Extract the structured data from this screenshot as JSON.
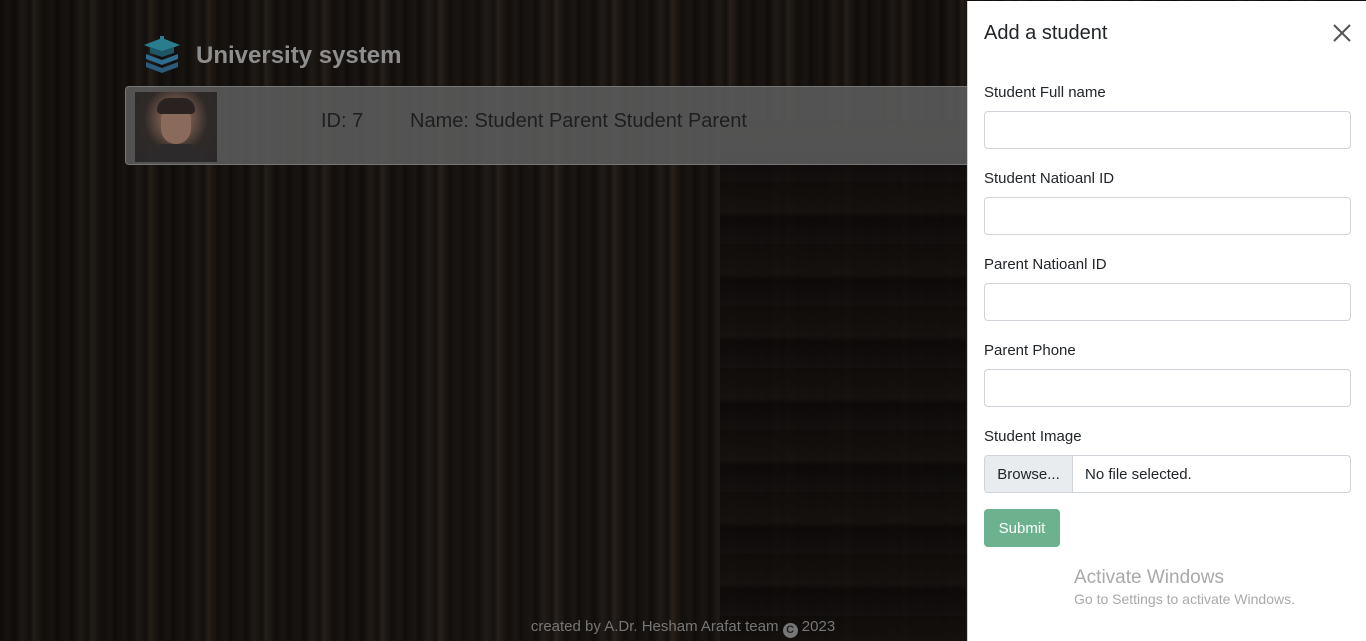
{
  "brand": {
    "title": "University system",
    "logo_icon": "graduation-books-icon"
  },
  "student_card": {
    "id_text": "ID: 7",
    "name_text": "Name: Student Parent Student Parent",
    "photo_icon": "student-photo"
  },
  "footer": {
    "prefix": "created by A.Dr. Hesham Arafat team",
    "copyright_symbol": "C",
    "year": "2023"
  },
  "panel": {
    "title": "Add a student",
    "close_icon": "close-icon",
    "fields": [
      {
        "label": "Student Full name",
        "value": "",
        "placeholder": ""
      },
      {
        "label": "Student Natioanl ID",
        "value": "",
        "placeholder": ""
      },
      {
        "label": "Parent Natioanl ID",
        "value": "",
        "placeholder": ""
      },
      {
        "label": "Parent Phone",
        "value": "",
        "placeholder": ""
      }
    ],
    "image_field": {
      "label": "Student Image",
      "browse_label": "Browse...",
      "status": "No file selected."
    },
    "submit_label": "Submit"
  },
  "watermark": {
    "line1": "Activate Windows",
    "line2": "Go to Settings to activate Windows."
  },
  "colors": {
    "submit": "#6db28f",
    "panel_bg": "#ffffff",
    "overlay": "rgba(0,0,0,0.55)"
  }
}
